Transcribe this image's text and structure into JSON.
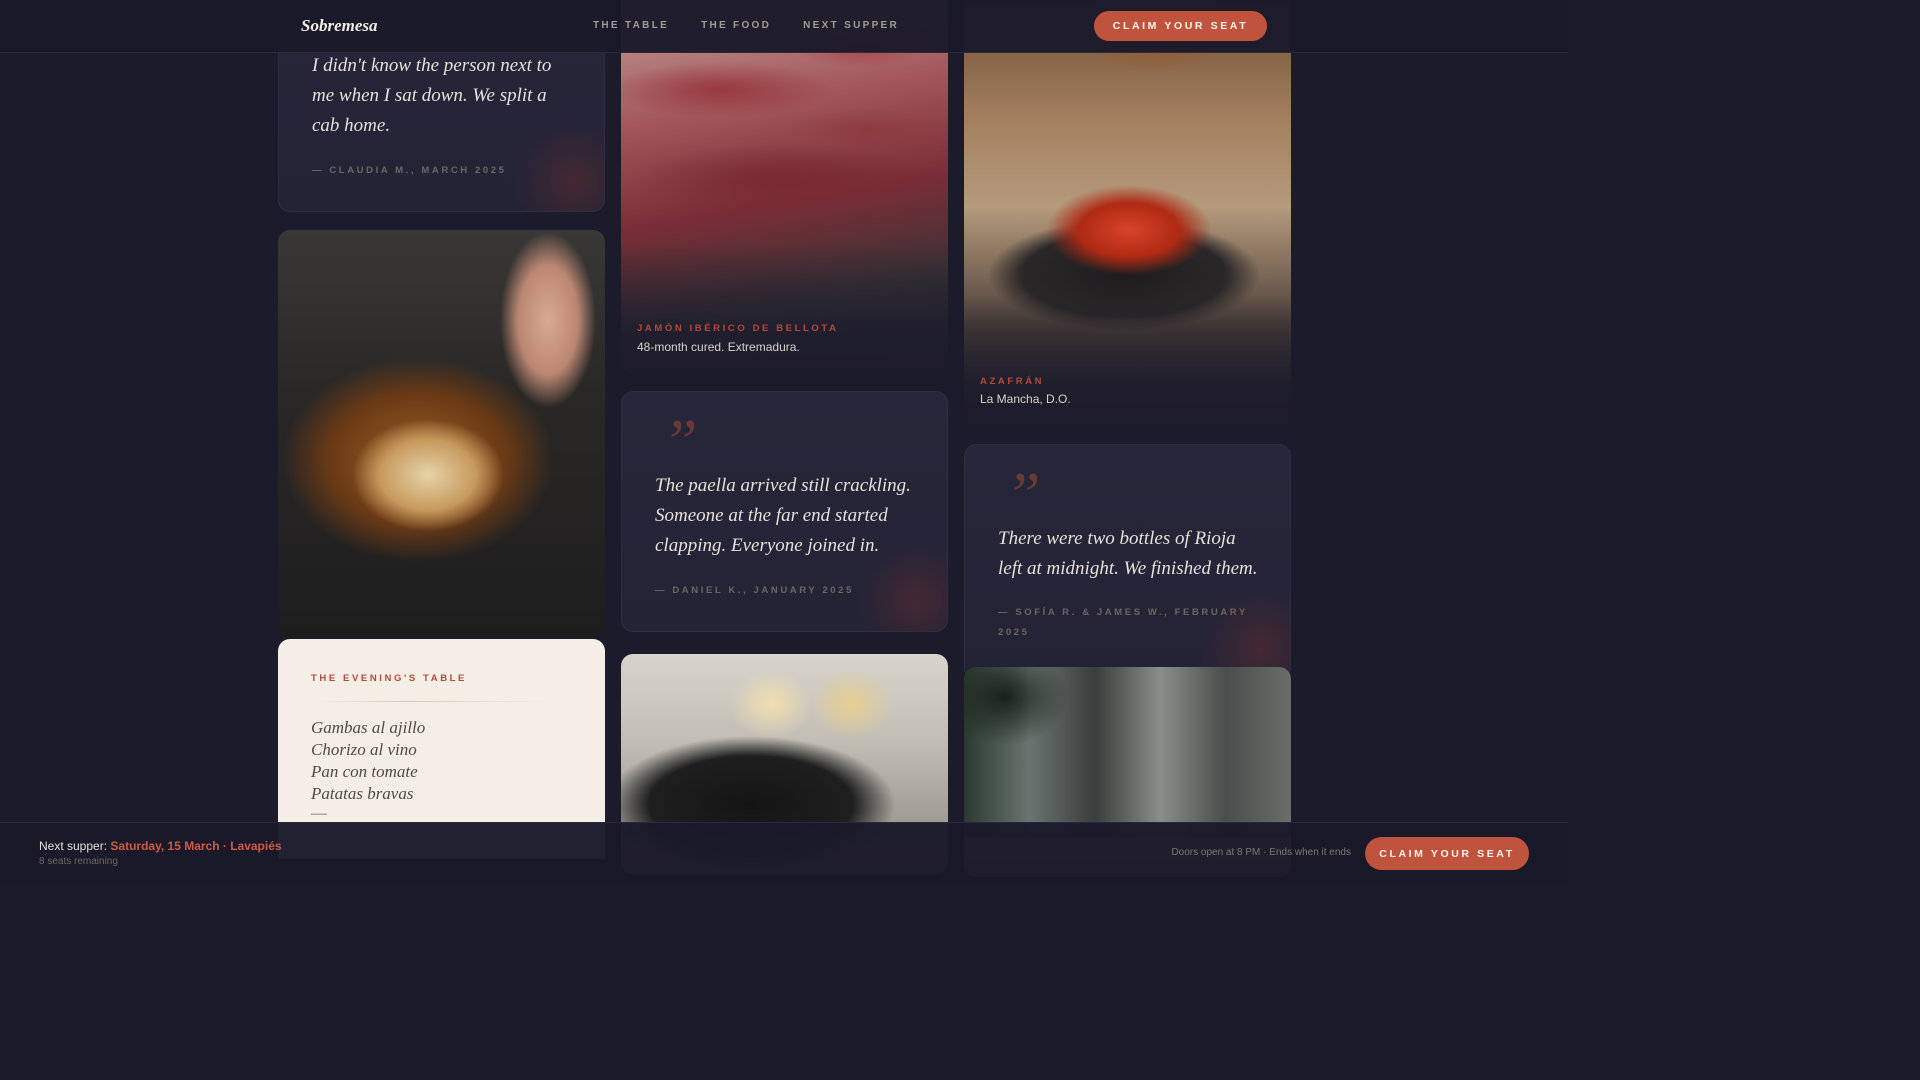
{
  "header": {
    "logo": "Sobremesa",
    "nav": [
      "THE TABLE",
      "THE FOOD",
      "NEXT SUPPER"
    ],
    "cta": "CLAIM YOUR SEAT"
  },
  "testimonials": [
    {
      "quote": "I didn't know the person next to me when I sat down. We split a cab home.",
      "author": "— CLAUDIA M., MARCH 2025"
    },
    {
      "quote": "The paella arrived still crackling. Someone at the far end started clapping. Everyone joined in.",
      "author": "— DANIEL K., JANUARY 2025"
    },
    {
      "quote": "There were two bottles of Rioja left at midnight. We finished them.",
      "author": "— SOFÍA R. & JAMES W., FEBRUARY 2025"
    }
  ],
  "quote_mark": "”",
  "dishes": [
    {
      "label": "JAMÓN IBÉRICO DE BELLOTA",
      "desc": "48-month cured. Extremadura."
    },
    {
      "label": "AZAFRÁN",
      "desc": "La Mancha, D.O."
    }
  ],
  "menu": {
    "label": "THE EVENING'S TABLE",
    "items": [
      "Gambas al ajillo",
      "Chorizo al vino",
      "Pan con tomate",
      "Patatas bravas"
    ],
    "dash": "—"
  },
  "footer": {
    "prefix": "Next supper:",
    "date_location": "Saturday, 15 March · Lavapiés",
    "seats": "8 seats remaining",
    "doors": "Doors open at 8 PM · Ends when it ends",
    "cta": "CLAIM YOUR SEAT"
  },
  "colors": {
    "background": "#1c1b2c",
    "accent": "#c0533e",
    "menu_card": "#f4eee6"
  }
}
